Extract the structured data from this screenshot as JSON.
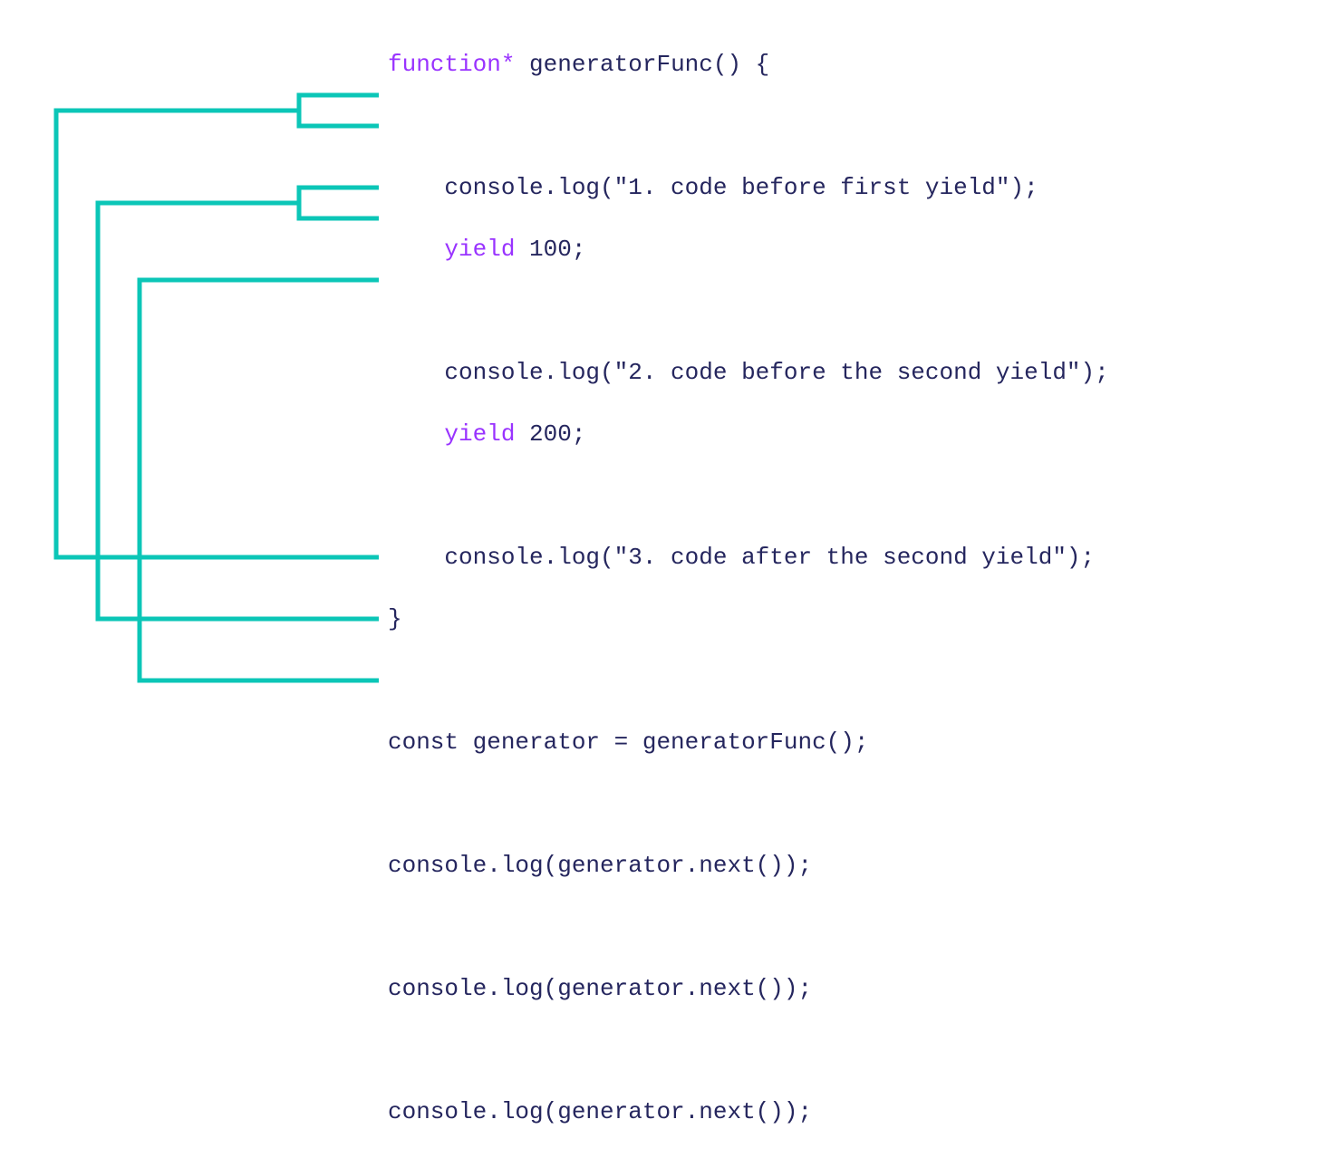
{
  "colors": {
    "keyword": "#9933FF",
    "text": "#25265E",
    "connector": "#0BC6B7"
  },
  "code": {
    "l1_kw": "function*",
    "l1_rest": " generatorFunc() {",
    "l3": "    console.log(\"1. code before first yield\");",
    "l4_indent": "    ",
    "l4_kw": "yield",
    "l4_rest": " 100;",
    "l6": "    console.log(\"2. code before the second yield\");",
    "l7_indent": "    ",
    "l7_kw": "yield",
    "l7_rest": " 200;",
    "l9": "    console.log(\"3. code after the second yield\");",
    "l10": "}",
    "l12": "const generator = generatorFunc();",
    "l14": "console.log(generator.next());",
    "l16": "console.log(generator.next());",
    "l18": "console.log(generator.next());"
  }
}
